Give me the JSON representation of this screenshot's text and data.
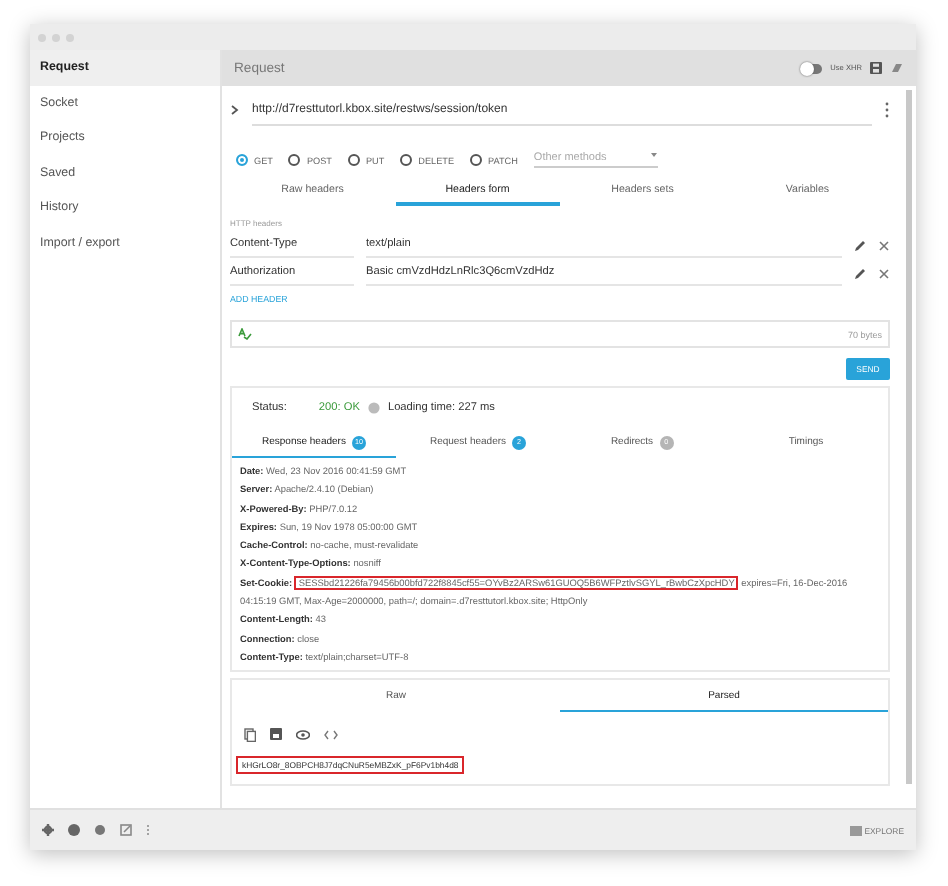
{
  "sidebar": {
    "items": [
      {
        "label": "Request",
        "selected": true
      },
      {
        "label": "Socket",
        "selected": false
      },
      {
        "label": "Projects",
        "selected": false
      },
      {
        "label": "Saved",
        "selected": false
      },
      {
        "label": "History",
        "selected": false
      },
      {
        "label": "Import / export",
        "selected": false
      }
    ]
  },
  "header": {
    "title": "Request",
    "use_xhr": {
      "label": "Use XHR",
      "on": false
    }
  },
  "url": "http://d7resttutorl.kbox.site/restws/session/token",
  "methods": [
    {
      "label": "GET",
      "selected": true
    },
    {
      "label": "POST",
      "selected": false
    },
    {
      "label": "PUT",
      "selected": false
    },
    {
      "label": "DELETE",
      "selected": false
    },
    {
      "label": "PATCH",
      "selected": false
    }
  ],
  "other_methods": {
    "placeholder": "Other methods"
  },
  "header_tabs": [
    {
      "label": "Raw headers",
      "selected": false
    },
    {
      "label": "Headers form",
      "selected": true
    },
    {
      "label": "Headers sets",
      "selected": false
    },
    {
      "label": "Variables",
      "selected": false
    }
  ],
  "headers_label": "HTTP headers",
  "headers": [
    {
      "name": "Content-Type",
      "value": "text/plain"
    },
    {
      "name": "Authorization",
      "value": "Basic cmVzdHdzLnRlc3Q6cmVzdHdz"
    }
  ],
  "add_header": "ADD HEADER",
  "body": {
    "size": "70 bytes"
  },
  "send": "SEND",
  "response": {
    "status_label": "Status:",
    "status": "200: OK",
    "loading_time": "Loading time: 227 ms",
    "tabs": [
      {
        "label": "Response headers",
        "count": "10",
        "color": "#29a3d9",
        "selected": true
      },
      {
        "label": "Request headers",
        "count": "2",
        "color": "#29a3d9",
        "selected": false
      },
      {
        "label": "Redirects",
        "count": "0",
        "color": "#b5b5b5",
        "selected": false
      },
      {
        "label": "Timings",
        "selected": false
      }
    ],
    "headers": [
      {
        "name": "Date:",
        "value": "Wed, 23 Nov 2016 00:41:59 GMT"
      },
      {
        "name": "Server:",
        "value": "Apache/2.4.10 (Debian)"
      },
      {
        "name": "X-Powered-By:",
        "value": "PHP/7.0.12"
      },
      {
        "name": "Expires:",
        "value": "Sun, 19 Nov 1978 05:00:00 GMT"
      },
      {
        "name": "Cache-Control:",
        "value": "no-cache, must-revalidate"
      },
      {
        "name": "X-Content-Type-Options:",
        "value": "nosniff"
      },
      {
        "name": "Set-Cookie:",
        "highlight": "SESSbd21226fa79456b00bfd722f8845cf55=OYvBz2ARSw61GUOQ5B6WFPztlvSGYL_rBwbCzXpcHDY",
        "value": "expires=Fri, 16-Dec-2016 04:15:19 GMT, Max-Age=2000000, path=/; domain=.d7resttutorl.kbox.site; HttpOnly"
      },
      {
        "name": "Content-Length:",
        "value": "43"
      },
      {
        "name": "Connection:",
        "value": "close"
      },
      {
        "name": "Content-Type:",
        "value": "text/plain;charset=UTF-8"
      }
    ],
    "body_tabs": [
      {
        "label": "Raw",
        "selected": false
      },
      {
        "label": "Parsed",
        "selected": true
      }
    ],
    "body_text": "kHGrLO8r_8OBPCH8J7dqCNuR5eMBZxK_pF6Pv1bh4d8"
  },
  "footer": {
    "explore": "EXPLORE"
  }
}
